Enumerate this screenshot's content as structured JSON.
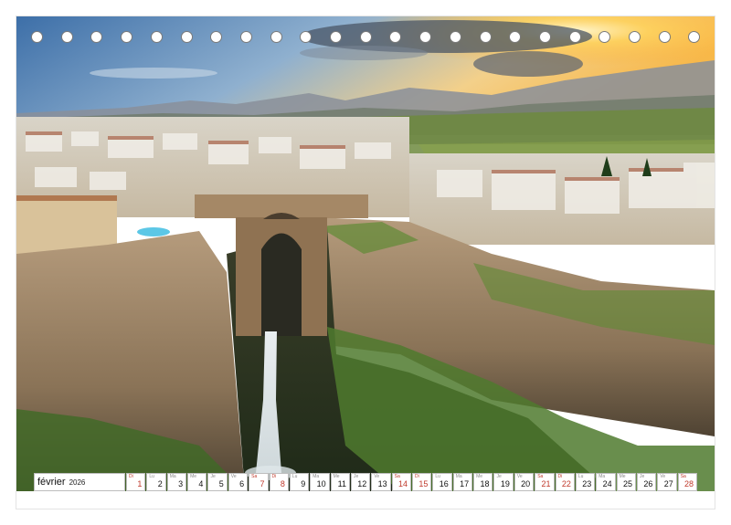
{
  "calendar": {
    "month_label": "février",
    "year_label": "2026",
    "days": [
      {
        "dow": "Di",
        "n": "1",
        "weekend": true
      },
      {
        "dow": "Lu",
        "n": "2",
        "weekend": false
      },
      {
        "dow": "Ma",
        "n": "3",
        "weekend": false
      },
      {
        "dow": "Me",
        "n": "4",
        "weekend": false
      },
      {
        "dow": "Je",
        "n": "5",
        "weekend": false
      },
      {
        "dow": "Ve",
        "n": "6",
        "weekend": false
      },
      {
        "dow": "Sa",
        "n": "7",
        "weekend": true
      },
      {
        "dow": "Di",
        "n": "8",
        "weekend": true
      },
      {
        "dow": "Lu",
        "n": "9",
        "weekend": false
      },
      {
        "dow": "Ma",
        "n": "10",
        "weekend": false
      },
      {
        "dow": "Me",
        "n": "11",
        "weekend": false
      },
      {
        "dow": "Je",
        "n": "12",
        "weekend": false
      },
      {
        "dow": "Ve",
        "n": "13",
        "weekend": false
      },
      {
        "dow": "Sa",
        "n": "14",
        "weekend": true
      },
      {
        "dow": "Di",
        "n": "15",
        "weekend": true
      },
      {
        "dow": "Lu",
        "n": "16",
        "weekend": false
      },
      {
        "dow": "Ma",
        "n": "17",
        "weekend": false
      },
      {
        "dow": "Me",
        "n": "18",
        "weekend": false
      },
      {
        "dow": "Je",
        "n": "19",
        "weekend": false
      },
      {
        "dow": "Ve",
        "n": "20",
        "weekend": false
      },
      {
        "dow": "Sa",
        "n": "21",
        "weekend": true
      },
      {
        "dow": "Di",
        "n": "22",
        "weekend": true
      },
      {
        "dow": "Lu",
        "n": "23",
        "weekend": false
      },
      {
        "dow": "Ma",
        "n": "24",
        "weekend": false
      },
      {
        "dow": "Me",
        "n": "25",
        "weekend": false
      },
      {
        "dow": "Je",
        "n": "26",
        "weekend": false
      },
      {
        "dow": "Ve",
        "n": "27",
        "weekend": false
      },
      {
        "dow": "Sa",
        "n": "28",
        "weekend": true
      }
    ]
  },
  "binding_holes": 23,
  "colors": {
    "weekend_number": "#c0392b",
    "sky_top": "#3d6fa8",
    "sun_glow": "#ffd35a",
    "cliff": "#9b8266",
    "vegetation": "#4f7a2e"
  }
}
